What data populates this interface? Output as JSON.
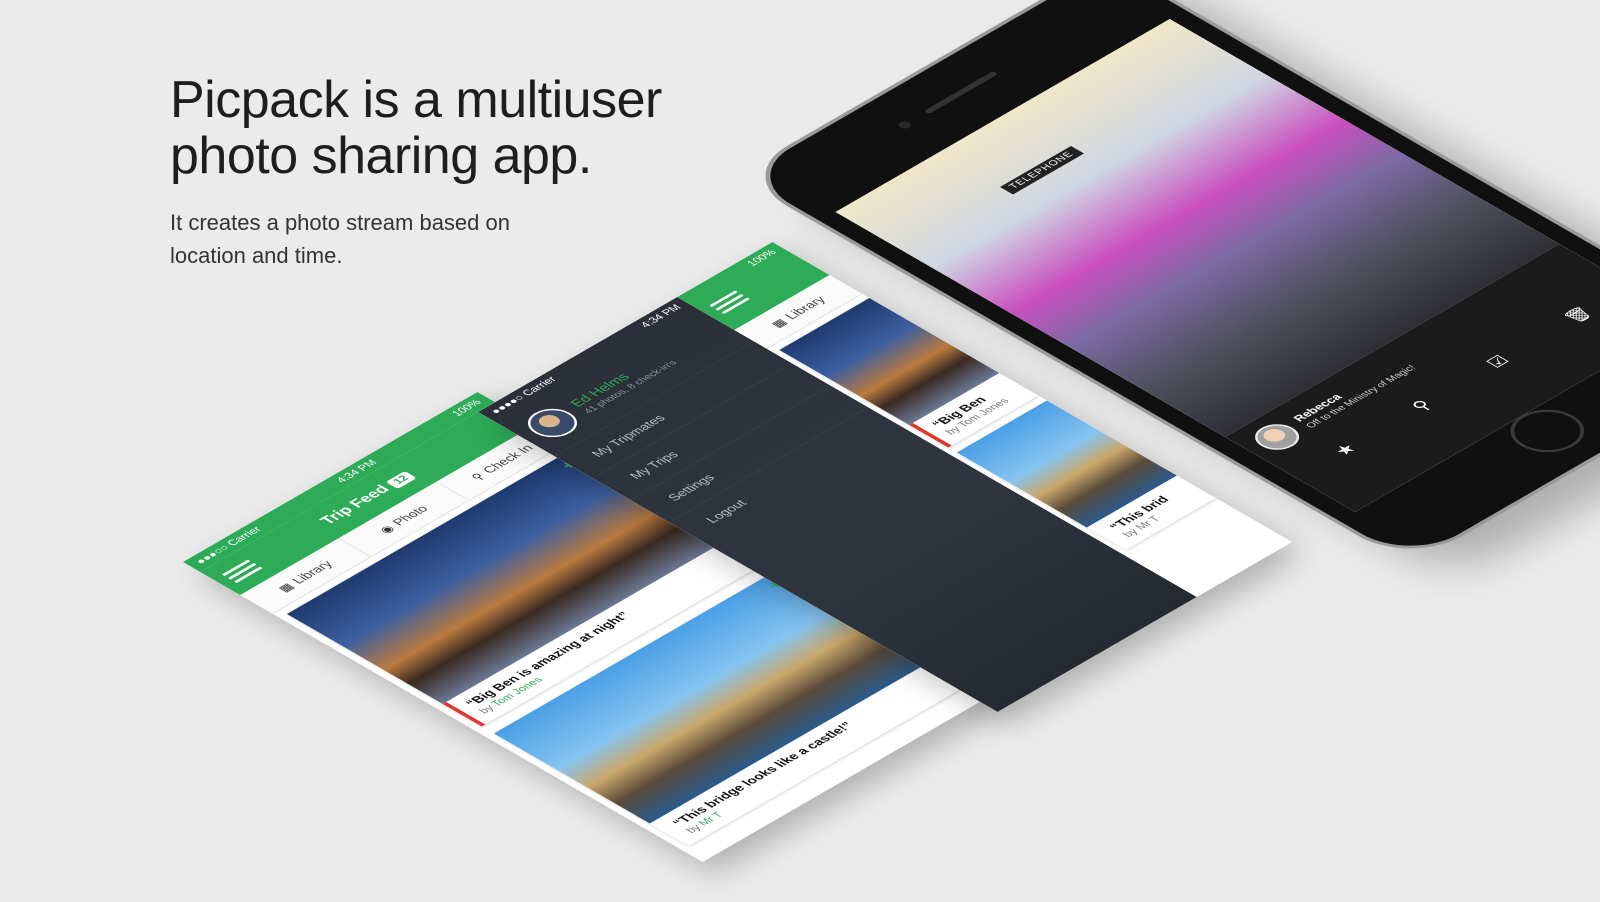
{
  "hero": {
    "headline": "Picpack is a multiuser photo sharing app.",
    "subline": "It creates a photo stream based on location and time."
  },
  "feed": {
    "status": {
      "carrier": "●●●○○ Carrier",
      "time": "4:34 PM",
      "battery": "100%"
    },
    "title": "Trip Feed",
    "badge": "12",
    "tabs": [
      {
        "label": "Library",
        "icon": "grid-icon"
      },
      {
        "label": "Photo",
        "icon": "camera-icon"
      },
      {
        "label": "Check In",
        "icon": "pin-icon"
      }
    ],
    "cards": [
      {
        "quote": "“Big Ben is amazing at night”",
        "by": "by",
        "author": "Tom Jones"
      },
      {
        "quote": "“This bridge looks like a castle!”",
        "by": "by",
        "author": "Mr T"
      }
    ]
  },
  "menu": {
    "status": {
      "carrier": "●●●●○ Carrier",
      "time": "4:34 PM",
      "battery": "100%"
    },
    "profile": {
      "name": "Ed Helms",
      "stats": "41 photos, 8 check-in's"
    },
    "items": [
      "My Tripmates",
      "My Trips",
      "Settings",
      "Logout"
    ],
    "peek": {
      "tab": "Library",
      "quote1": "“Big Ben",
      "author1": "by Tom Jones",
      "quote2": "“This brid",
      "author2": "by Mr T"
    }
  },
  "viewer": {
    "booth_text": "TELEPHONE",
    "user": "Rebecca",
    "caption": "Off to the Ministry of Magic!",
    "actions": [
      "star-icon",
      "pin-icon",
      "checkin-icon",
      "trash-icon"
    ]
  },
  "colors": {
    "brand": "#2eab57",
    "accent": "#e0362d",
    "drawer": "#2b3038",
    "background": "#ebebeb"
  }
}
